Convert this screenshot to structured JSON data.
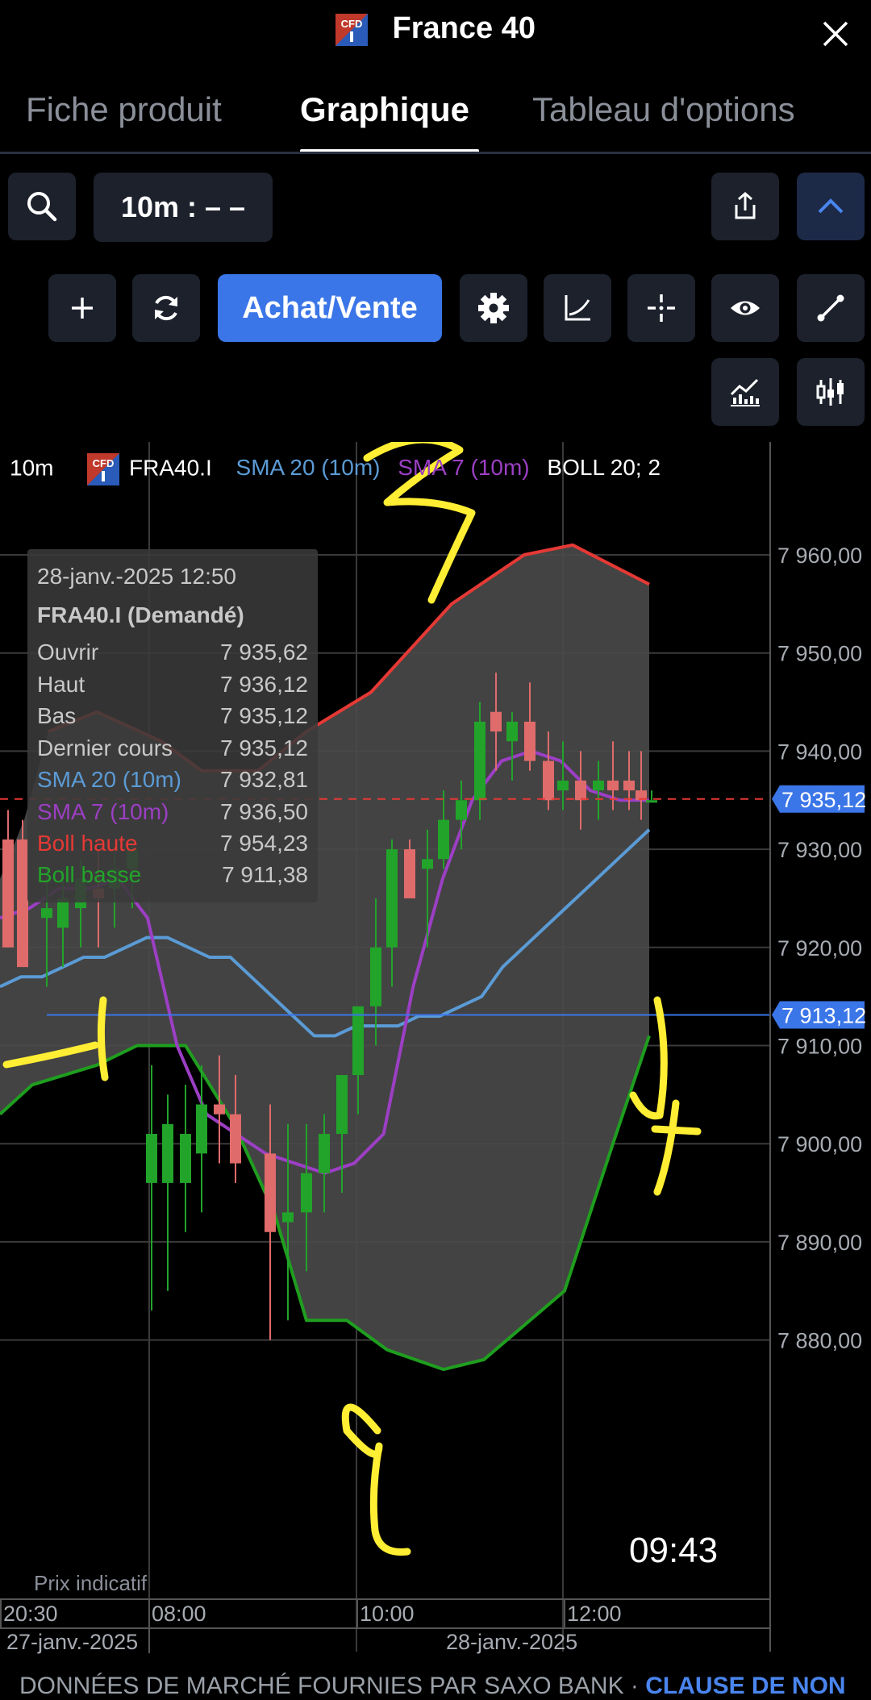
{
  "header": {
    "title": "France 40",
    "logo_text": "CFD",
    "close_icon": "close-icon"
  },
  "tabs": [
    {
      "label": "Fiche produit",
      "active": false
    },
    {
      "label": "Graphique",
      "active": true
    },
    {
      "label": "Tableau d'options",
      "active": false
    }
  ],
  "toolbar": {
    "timeframe_label": "10m : – –",
    "buy_sell_label": "Achat/Vente",
    "icons": [
      "search-icon",
      "share-icon",
      "chevron-up-icon",
      "plus-icon",
      "refresh-icon",
      "gear-icon",
      "curve-icon",
      "crosshair-icon",
      "eye-icon",
      "draw-line-icon",
      "indicator-icon",
      "candlestick-icon"
    ]
  },
  "legend": {
    "timeframe": "10m",
    "symbol": "FRA40.I",
    "sma20": "SMA 20 (10m)",
    "sma7": "SMA 7 (10m)",
    "boll": "BOLL 20; 2"
  },
  "tooltip": {
    "datetime": "28-janv.-2025 12:50",
    "instrument": "FRA40.I (Demandé)",
    "rows": [
      {
        "label": "Ouvrir",
        "value": "7 935,62"
      },
      {
        "label": "Haut",
        "value": "7 936,12"
      },
      {
        "label": "Bas",
        "value": "7 935,12"
      },
      {
        "label": "Dernier cours",
        "value": "7 935,12"
      },
      {
        "label": "SMA 20 (10m)",
        "value": "7 932,81"
      },
      {
        "label": "SMA 7 (10m)",
        "value": "7 936,50"
      },
      {
        "label": "Boll haute",
        "value": "7 954,23"
      },
      {
        "label": "Boll basse",
        "value": "7 911,38"
      }
    ]
  },
  "price_tags": {
    "last": "7 935,12",
    "line": "7 913,12"
  },
  "indicative_label": "Prix indicatif",
  "clock": "09:43",
  "footer": {
    "text": "DONNÉES DE MARCHÉ FOURNIES PAR SAXO BANK · ",
    "link": "CLAUSE DE NON"
  },
  "colors": {
    "bull": "#22a32a",
    "bear": "#e06b6b",
    "sma20": "#5b9bd5",
    "sma7": "#9c3fc4",
    "boll_upper": "#e53935",
    "boll_lower": "#1f9e1f",
    "band": "#444444",
    "accent": "#3b76e8",
    "annotation": "#ffee33"
  },
  "annotations": [
    "1",
    "2",
    "3",
    "4"
  ],
  "chart_data": {
    "type": "candlestick",
    "timeframe": "10m",
    "ylim": [
      7876,
      7963
    ],
    "y_ticks": [
      7960,
      7950,
      7940,
      7930,
      7920,
      7910,
      7900,
      7890,
      7880
    ],
    "y_tick_labels": [
      "7 960,00",
      "7 950,00",
      "7 940,00",
      "7 930,00",
      "7 920,00",
      "7 910,00",
      "7 900,00",
      "7 890,00",
      "7 880,00"
    ],
    "x_tick_labels": [
      "20:30",
      "08:00",
      "10:00",
      "12:00"
    ],
    "date_labels": [
      "27-janv.-2025",
      "28-janv.-2025"
    ],
    "last_price": 7935.12,
    "horizontal_line": 7913.12,
    "candles": [
      {
        "o": 7931,
        "h": 7934,
        "l": 7920,
        "c": 7920
      },
      {
        "o": 7931,
        "h": 7933,
        "l": 7919,
        "c": 7918
      },
      {
        "o": 7923,
        "h": 7928,
        "l": 7916,
        "c": 7924
      },
      {
        "o": 7922,
        "h": 7928,
        "l": 7918,
        "c": 7925
      },
      {
        "o": 7924,
        "h": 7929,
        "l": 7920,
        "c": 7927
      },
      {
        "o": 7926,
        "h": 7930,
        "l": 7920,
        "c": 7925
      },
      {
        "o": 7926,
        "h": 7930,
        "l": 7922,
        "c": 7928
      },
      {
        "o": 7928,
        "h": 7931,
        "l": 7924,
        "c": 7930
      },
      {
        "o": 7896,
        "h": 7908,
        "l": 7883,
        "c": 7901
      },
      {
        "o": 7896,
        "h": 7905,
        "l": 7885,
        "c": 7902
      },
      {
        "o": 7896,
        "h": 7906,
        "l": 7891,
        "c": 7901
      },
      {
        "o": 7899,
        "h": 7908,
        "l": 7893,
        "c": 7904
      },
      {
        "o": 7904,
        "h": 7909,
        "l": 7898,
        "c": 7903
      },
      {
        "o": 7903,
        "h": 7907,
        "l": 7896,
        "c": 7898
      },
      {
        "o": 7899,
        "h": 7904,
        "l": 7880,
        "c": 7891
      },
      {
        "o": 7892,
        "h": 7902,
        "l": 7882,
        "c": 7893
      },
      {
        "o": 7893,
        "h": 7902,
        "l": 7887,
        "c": 7897
      },
      {
        "o": 7897,
        "h": 7903,
        "l": 7893,
        "c": 7901
      },
      {
        "o": 7901,
        "h": 7907,
        "l": 7895,
        "c": 7907
      },
      {
        "o": 7907,
        "h": 7913,
        "l": 7903,
        "c": 7914
      },
      {
        "o": 7914,
        "h": 7925,
        "l": 7910,
        "c": 7920
      },
      {
        "o": 7920,
        "h": 7931,
        "l": 7916,
        "c": 7930
      },
      {
        "o": 7930,
        "h": 7931,
        "l": 7926,
        "c": 7925
      },
      {
        "o": 7928,
        "h": 7932,
        "l": 7920,
        "c": 7929
      },
      {
        "o": 7929,
        "h": 7936,
        "l": 7928,
        "c": 7933
      },
      {
        "o": 7933,
        "h": 7937,
        "l": 7930,
        "c": 7935
      },
      {
        "o": 7935,
        "h": 7945,
        "l": 7933,
        "c": 7943
      },
      {
        "o": 7944,
        "h": 7948,
        "l": 7938,
        "c": 7942
      },
      {
        "o": 7941,
        "h": 7944,
        "l": 7937,
        "c": 7943
      },
      {
        "o": 7943,
        "h": 7947,
        "l": 7938,
        "c": 7939
      },
      {
        "o": 7939,
        "h": 7942,
        "l": 7934,
        "c": 7935
      },
      {
        "o": 7936,
        "h": 7941,
        "l": 7934,
        "c": 7937
      },
      {
        "o": 7937,
        "h": 7940,
        "l": 7932,
        "c": 7935
      },
      {
        "o": 7936,
        "h": 7939,
        "l": 7933,
        "c": 7937
      },
      {
        "o": 7937,
        "h": 7941,
        "l": 7934,
        "c": 7936
      },
      {
        "o": 7937,
        "h": 7940,
        "l": 7934,
        "c": 7936
      },
      {
        "o": 7936,
        "h": 7940,
        "l": 7933,
        "c": 7935
      },
      {
        "o": 7935,
        "h": 7936,
        "l": 7935,
        "c": 7935
      }
    ],
    "sma20": [
      7916,
      7917,
      7917,
      7918,
      7919,
      7919,
      7920,
      7921,
      7921,
      7920,
      7919,
      7919,
      7917,
      7915,
      7913,
      7911,
      7911,
      7912,
      7912,
      7912,
      7913,
      7913,
      7914,
      7915,
      7918,
      7920,
      7922,
      7924,
      7926,
      7928,
      7930,
      7932
    ],
    "sma7": [
      7923,
      7924,
      7926,
      7926,
      7927,
      7923,
      7910,
      7903,
      7901,
      7899,
      7898,
      7897,
      7898,
      7901,
      7916,
      7927,
      7935,
      7939,
      7940,
      7939,
      7936,
      7935,
      7935
    ],
    "boll_upper": [
      7942,
      7944,
      7941,
      7938,
      7938,
      7942,
      7946,
      7955,
      7960,
      7961,
      7957
    ],
    "boll_lower": [
      7903,
      7906,
      7908,
      7910,
      7910,
      7902,
      7893,
      7882,
      7882,
      7879,
      7877,
      7878,
      7885,
      7900,
      7911
    ]
  }
}
